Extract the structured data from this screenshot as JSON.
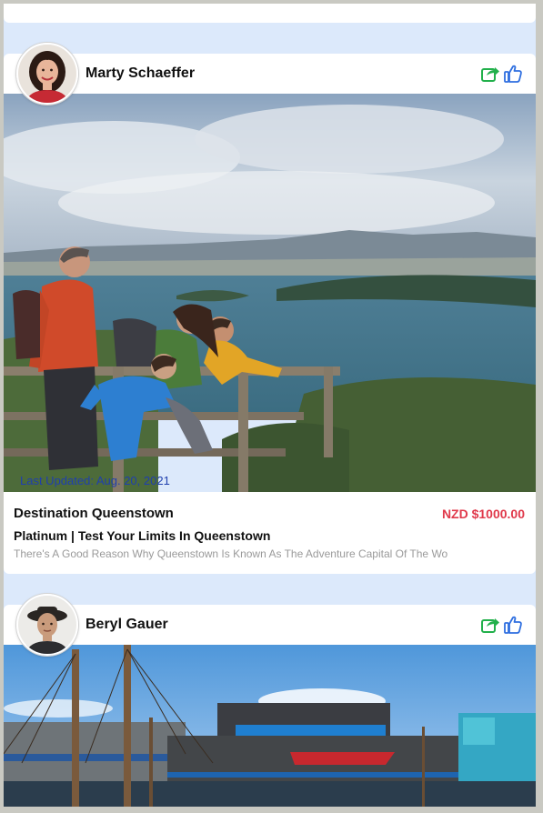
{
  "posts": [
    {
      "author": "Marty Schaeffer",
      "last_updated": "Last Updated: Aug. 20, 2021",
      "title": "Destination Queenstown",
      "price": "NZD $1000.00",
      "package": "Platinum | Test Your Limits In Queenstown",
      "description": "There's A Good Reason Why Queenstown Is Known As The Adventure Capital Of The Wo"
    },
    {
      "author": "Beryl Gauer"
    }
  ],
  "icons": {
    "share": "share-icon",
    "like": "thumbs-up-icon"
  },
  "colors": {
    "feed_background": "#dce9fb",
    "price": "#e0394b",
    "updated_text": "#1f3fae",
    "share_icon": "#22b04b",
    "like_icon": "#2f6fe0"
  }
}
